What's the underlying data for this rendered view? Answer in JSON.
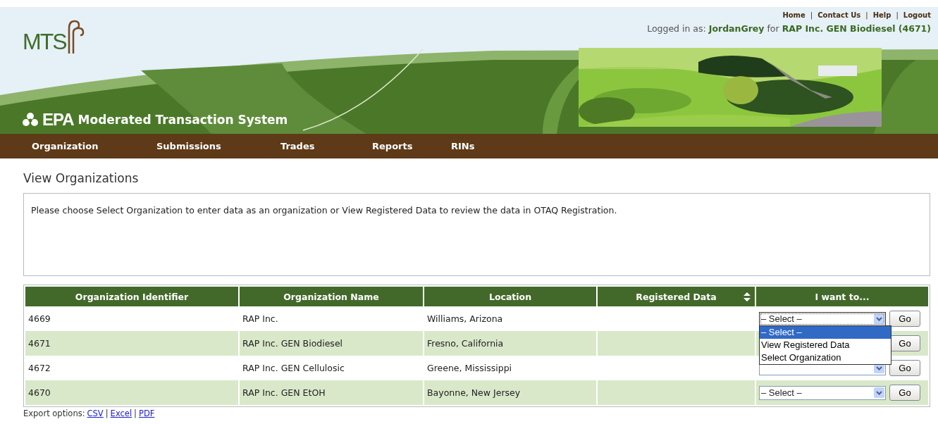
{
  "top_links": {
    "items": [
      "Home",
      "Contact Us",
      "Help",
      "Logout"
    ],
    "separator": "|"
  },
  "login_text": "Logged in as: **JordanGrey** for **RAP Inc. GEN Biodiesel (4671)**",
  "logo": {
    "text": "MTS",
    "agency": "EPA",
    "system": "Moderated Transaction System"
  },
  "nav": [
    {
      "label": "Organization"
    },
    {
      "label": "Submissions"
    },
    {
      "label": "Trades"
    },
    {
      "label": "Reports"
    },
    {
      "label": "RINs"
    }
  ],
  "page_title": "View Organizations",
  "message": "Please choose Select Organization to enter data as an organization or View Registered Data to review the data in OTAQ Registration.",
  "table": {
    "columns": [
      {
        "label": "Organization Identifier",
        "sortable": false
      },
      {
        "label": "Organization Name",
        "sortable": false
      },
      {
        "label": "Location",
        "sortable": false
      },
      {
        "label": "Registered Data",
        "sortable": true
      },
      {
        "label": "I want to...",
        "sortable": false
      }
    ],
    "rows": [
      {
        "id": "4669",
        "name": "RAP Inc.",
        "location": "Williams, Arizona",
        "select": {
          "value": "– Select –",
          "open": true,
          "options": [
            {
              "label": "– Select –",
              "selected": true
            },
            {
              "label": "View Registered Data",
              "selected": false
            },
            {
              "label": "Select Organization",
              "selected": false
            }
          ]
        },
        "button": "Go"
      },
      {
        "id": "4671",
        "name": "RAP Inc. GEN Biodiesel",
        "location": "Fresno, California",
        "button": "Go"
      },
      {
        "id": "4672",
        "name": "RAP Inc. GEN Cellulosic",
        "location": "Greene, Mississippi",
        "select": {
          "open": false
        },
        "button": "Go"
      },
      {
        "id": "4670",
        "name": "RAP Inc. GEN EtOH",
        "location": "Bayonne, New Jersey",
        "select": {
          "value": "– Select –",
          "open": false
        },
        "button": "Go"
      }
    ]
  },
  "export": {
    "label": "Export options:",
    "links": [
      "CSV",
      "Excel",
      "PDF"
    ],
    "separator": "|"
  }
}
